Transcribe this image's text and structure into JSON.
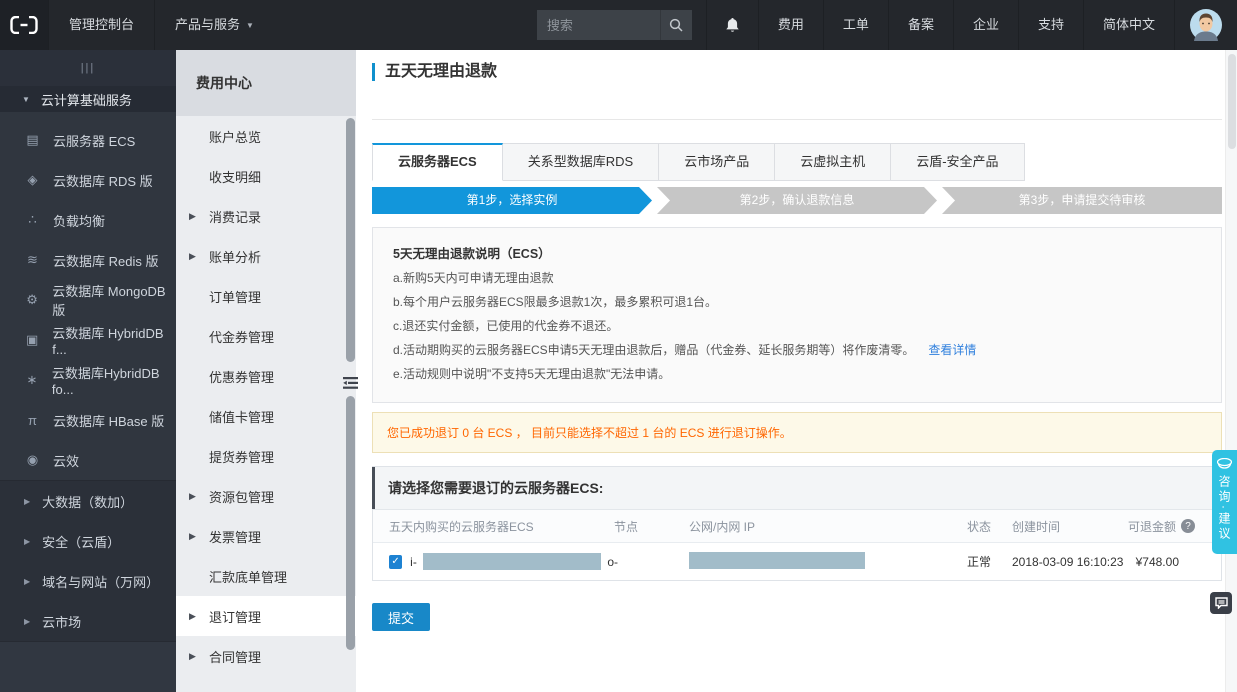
{
  "topnav": {
    "console_label": "管理控制台",
    "products_label": "产品与服务",
    "search_placeholder": "搜索",
    "links": [
      "费用",
      "工单",
      "备案",
      "企业",
      "支持",
      "简体中文"
    ]
  },
  "sidebar": {
    "collapse_glyph": "|||",
    "section_header": "云计算基础服务",
    "services": [
      {
        "label": "云服务器 ECS",
        "glyph": "▤"
      },
      {
        "label": "云数据库 RDS 版",
        "glyph": "◈"
      },
      {
        "label": "负载均衡",
        "glyph": "∴"
      },
      {
        "label": "云数据库 Redis 版",
        "glyph": "≋"
      },
      {
        "label": "云数据库 MongoDB 版",
        "glyph": "⚙"
      },
      {
        "label": "云数据库 HybridDB f...",
        "glyph": "▣"
      },
      {
        "label": "云数据库HybridDB fo...",
        "glyph": "∗"
      },
      {
        "label": "云数据库 HBase 版",
        "glyph": "π"
      },
      {
        "label": "云效",
        "glyph": "◉"
      }
    ],
    "groups": [
      {
        "label": "大数据（数加）"
      },
      {
        "label": "安全（云盾）"
      },
      {
        "label": "域名与网站（万网）"
      },
      {
        "label": "云市场"
      }
    ]
  },
  "submenu": {
    "title": "费用中心",
    "items": [
      {
        "label": "账户总览",
        "expandable": false,
        "selected": false
      },
      {
        "label": "收支明细",
        "expandable": false,
        "selected": false
      },
      {
        "label": "消费记录",
        "expandable": true,
        "selected": false
      },
      {
        "label": "账单分析",
        "expandable": true,
        "selected": false
      },
      {
        "label": "订单管理",
        "expandable": false,
        "selected": false
      },
      {
        "label": "代金券管理",
        "expandable": false,
        "selected": false
      },
      {
        "label": "优惠券管理",
        "expandable": false,
        "selected": false
      },
      {
        "label": "储值卡管理",
        "expandable": false,
        "selected": false
      },
      {
        "label": "提货券管理",
        "expandable": false,
        "selected": false
      },
      {
        "label": "资源包管理",
        "expandable": true,
        "selected": false
      },
      {
        "label": "发票管理",
        "expandable": true,
        "selected": false
      },
      {
        "label": "汇款底单管理",
        "expandable": false,
        "selected": false
      },
      {
        "label": "退订管理",
        "expandable": true,
        "selected": true
      },
      {
        "label": "合同管理",
        "expandable": true,
        "selected": false
      }
    ]
  },
  "main": {
    "page_title": "五天无理由退款",
    "tabs": [
      {
        "label": "云服务器ECS",
        "active": true
      },
      {
        "label": "关系型数据库RDS",
        "active": false
      },
      {
        "label": "云市场产品",
        "active": false
      },
      {
        "label": "云虚拟主机",
        "active": false
      },
      {
        "label": "云盾-安全产品",
        "active": false
      }
    ],
    "steps": [
      {
        "label": "第1步，选择实例",
        "active": true
      },
      {
        "label": "第2步，确认退款信息",
        "active": false
      },
      {
        "label": "第3步，申请提交待审核",
        "active": false
      }
    ],
    "refund_notes": {
      "title": "5天无理由退款说明（ECS）",
      "line_a": "a.新购5天内可申请无理由退款",
      "line_b": "b.每个用户云服务器ECS限最多退款1次，最多累积可退1台。",
      "line_c": "c.退还实付金额，已使用的代金券不退还。",
      "line_d": "d.活动期购买的云服务器ECS申请5天无理由退款后，赠品（代金券、延长服务期等）将作废清零。",
      "line_d_link": "查看详情",
      "line_e": "e.活动规则中说明\"不支持5天无理由退款\"无法申请。"
    },
    "warning": "您已成功退订 0 台 ECS ， 目前只能选择不超过 1 台的 ECS 进行退订操作。",
    "table": {
      "caption": "请选择您需要退订的云服务器ECS:",
      "columns": [
        "五天内购买的云服务器ECS",
        "节点",
        "公网/内网 IP",
        "状态",
        "创建时间",
        "可退金额"
      ],
      "row": {
        "checked": true,
        "instance_prefix": "i-",
        "instance_suffix": "o",
        "node": "-",
        "status": "正常",
        "created_at": "2018-03-09 16:10:23",
        "refund_amount": "¥748.00"
      }
    },
    "submit_label": "提交"
  },
  "floating": {
    "feedback_label": "咨询·建议"
  },
  "colors": {
    "accent_blue": "#1296db",
    "button_blue": "#1888c8",
    "step_inactive": "#c6c6c6",
    "warning_text": "#ff6600",
    "warning_bg": "#fdf9e8",
    "feedback_cyan": "#30c2e2",
    "redaction": "#a2bcc9",
    "link_blue": "#3080dd"
  }
}
